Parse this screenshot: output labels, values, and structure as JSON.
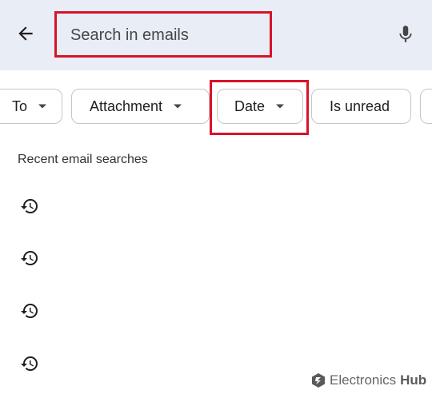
{
  "search": {
    "placeholder": "Search in emails"
  },
  "filters": [
    {
      "label": "To"
    },
    {
      "label": "Attachment"
    },
    {
      "label": "Date"
    },
    {
      "label": "Is unread"
    }
  ],
  "recent": {
    "title": "Recent email searches",
    "items": [
      {
        "icon": "history-icon",
        "text": ""
      },
      {
        "icon": "history-icon",
        "text": ""
      },
      {
        "icon": "history-icon",
        "text": ""
      },
      {
        "icon": "history-icon",
        "text": ""
      }
    ]
  },
  "watermark": {
    "name": "Electronics",
    "suffix": "Hub"
  },
  "colors": {
    "topbar_bg": "#e9edf5",
    "highlight": "#d8132a"
  }
}
